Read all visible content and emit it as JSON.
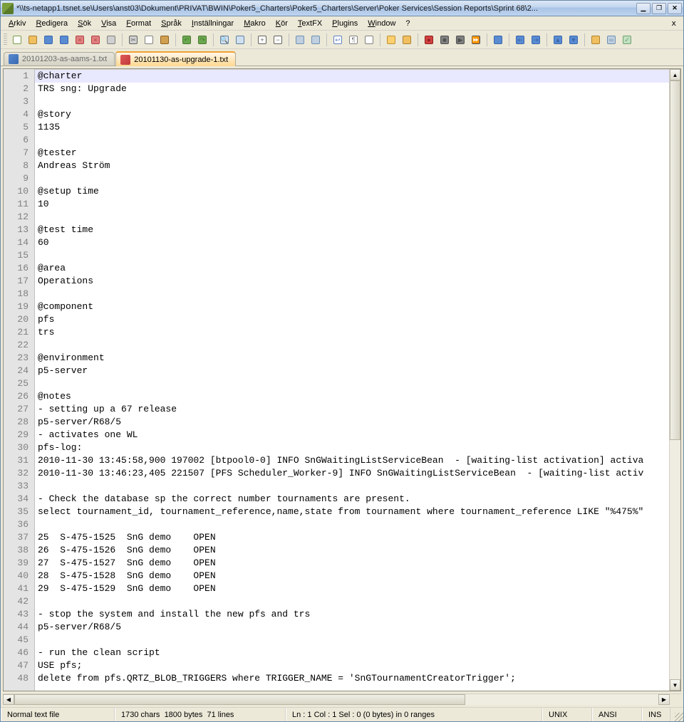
{
  "window": {
    "title_prefix": "*",
    "title_path": "\\\\ts-netapp1.tsnet.se\\Users\\anst03\\Dokument\\PRIVAT\\BWIN\\Poker5_Charters\\Poker5_Charters\\Server\\Poker Services\\Session Reports\\Sprint 68\\2..."
  },
  "menu": {
    "items": [
      "Arkiv",
      "Redigera",
      "Sök",
      "Visa",
      "Format",
      "Språk",
      "Inställningar",
      "Makro",
      "Kör",
      "TextFX",
      "Plugins",
      "Window",
      "?"
    ]
  },
  "toolbar1": {
    "icons": [
      "new-icon",
      "open-icon",
      "save-icon",
      "save-all-icon",
      "close-icon",
      "close-all-icon",
      "print-icon",
      "SEP",
      "cut-icon",
      "copy-icon",
      "paste-icon",
      "SEP",
      "undo-icon",
      "redo-icon",
      "SEP",
      "find-icon",
      "replace-icon",
      "SEP",
      "zoom-in-icon",
      "zoom-out-icon",
      "SEP",
      "sync-v-icon",
      "sync-h-icon",
      "SEP",
      "wrap-icon",
      "invisible-icon",
      "indent-guide-icon",
      "SEP",
      "lang-icon",
      "folder-icon",
      "SEP",
      "record-icon",
      "stop-icon",
      "play-icon",
      "play-multi-icon",
      "SEP",
      "save-macro-icon",
      "SEP",
      "outdent-icon",
      "indent-icon",
      "SEP",
      "collapse-icon",
      "expand-icon",
      "SEP",
      "explorer-icon",
      "link-icon",
      "spell-icon"
    ]
  },
  "tabs": [
    {
      "name": "20101203-as-aams-1.txt",
      "active": false,
      "iconColor": "blue"
    },
    {
      "name": "20101130-as-upgrade-1.txt",
      "active": true,
      "iconColor": "red"
    }
  ],
  "editor": {
    "lines": [
      "@charter",
      "TRS sng: Upgrade",
      "",
      "@story",
      "1135",
      "",
      "@tester",
      "Andreas Ström",
      "",
      "@setup time",
      "10",
      "",
      "@test time",
      "60",
      "",
      "@area",
      "Operations",
      "",
      "@component",
      "pfs",
      "trs",
      "",
      "@environment",
      "p5-server",
      "",
      "@notes",
      "- setting up a 67 release",
      "p5-server/R68/5",
      "- activates one WL",
      "pfs-log:",
      "2010-11-30 13:45:58,900 197002 [btpool0-0] INFO SnGWaitingListServiceBean  - [waiting-list activation] activa",
      "2010-11-30 13:46:23,405 221507 [PFS Scheduler_Worker-9] INFO SnGWaitingListServiceBean  - [waiting-list activ",
      "",
      "- Check the database sp the correct number tournaments are present.",
      "select tournament_id, tournament_reference,name,state from tournament where tournament_reference LIKE \"%475%\"",
      "",
      "25  S-475-1525  SnG demo    OPEN",
      "26  S-475-1526  SnG demo    OPEN",
      "27  S-475-1527  SnG demo    OPEN",
      "28  S-475-1528  SnG demo    OPEN",
      "29  S-475-1529  SnG demo    OPEN",
      "",
      "- stop the system and install the new pfs and trs",
      "p5-server/R68/5",
      "",
      "- run the clean script",
      "USE pfs;",
      "delete from pfs.QRTZ_BLOB_TRIGGERS where TRIGGER_NAME = 'SnGTournamentCreatorTrigger';"
    ],
    "current_line_index": 0
  },
  "status": {
    "filetype": "Normal text file",
    "chars": "1730 chars",
    "bytes": "1800 bytes",
    "lines": "71 lines",
    "pos": "Ln : 1    Col : 1    Sel : 0 (0 bytes) in 0 ranges",
    "eol": "UNIX",
    "enc": "ANSI",
    "mode": "INS"
  },
  "icon_glyphs": {
    "new-icon": {
      "fill": "#fff",
      "stroke": "#7a9a4a",
      "symbol": ""
    },
    "open-icon": {
      "fill": "#f0c060",
      "stroke": "#b08030",
      "symbol": ""
    },
    "save-icon": {
      "fill": "#5a8ad0",
      "stroke": "#3868b0",
      "symbol": ""
    },
    "save-all-icon": {
      "fill": "#5a8ad0",
      "stroke": "#3868b0",
      "symbol": ""
    },
    "close-icon": {
      "fill": "#e08080",
      "stroke": "#b04040",
      "symbol": "×"
    },
    "close-all-icon": {
      "fill": "#e08080",
      "stroke": "#b04040",
      "symbol": "×"
    },
    "print-icon": {
      "fill": "#d0d0d0",
      "stroke": "#808080",
      "symbol": ""
    },
    "cut-icon": {
      "fill": "#d0d0d0",
      "stroke": "#606060",
      "symbol": "✂"
    },
    "copy-icon": {
      "fill": "#fff",
      "stroke": "#808080",
      "symbol": ""
    },
    "paste-icon": {
      "fill": "#d0a050",
      "stroke": "#906020",
      "symbol": ""
    },
    "undo-icon": {
      "fill": "#6aa84f",
      "stroke": "#4a7a30",
      "symbol": "↶"
    },
    "redo-icon": {
      "fill": "#6aa84f",
      "stroke": "#4a7a30",
      "symbol": "↷"
    },
    "find-icon": {
      "fill": "#d0e0f0",
      "stroke": "#6080a0",
      "symbol": "🔍"
    },
    "replace-icon": {
      "fill": "#d0e0f0",
      "stroke": "#6080a0",
      "symbol": ""
    },
    "zoom-in-icon": {
      "fill": "#fff",
      "stroke": "#606060",
      "symbol": "+"
    },
    "zoom-out-icon": {
      "fill": "#fff",
      "stroke": "#606060",
      "symbol": "−"
    },
    "sync-v-icon": {
      "fill": "#c0d0e0",
      "stroke": "#7090b0",
      "symbol": ""
    },
    "sync-h-icon": {
      "fill": "#c0d0e0",
      "stroke": "#7090b0",
      "symbol": ""
    },
    "wrap-icon": {
      "fill": "#fff",
      "stroke": "#6080c0",
      "symbol": "↩"
    },
    "invisible-icon": {
      "fill": "#fff",
      "stroke": "#808080",
      "symbol": "¶"
    },
    "indent-guide-icon": {
      "fill": "#fff",
      "stroke": "#808080",
      "symbol": ""
    },
    "lang-icon": {
      "fill": "#ffd070",
      "stroke": "#c09030",
      "symbol": ""
    },
    "folder-icon": {
      "fill": "#f0c060",
      "stroke": "#b08030",
      "symbol": ""
    },
    "record-icon": {
      "fill": "#d04040",
      "stroke": "#902020",
      "symbol": "●"
    },
    "stop-icon": {
      "fill": "#808080",
      "stroke": "#505050",
      "symbol": "■"
    },
    "play-icon": {
      "fill": "#808080",
      "stroke": "#505050",
      "symbol": "▶"
    },
    "play-multi-icon": {
      "fill": "#808080",
      "stroke": "#505050",
      "symbol": "⏩"
    },
    "save-macro-icon": {
      "fill": "#5a8ad0",
      "stroke": "#3868b0",
      "symbol": ""
    },
    "outdent-icon": {
      "fill": "#5a8ad0",
      "stroke": "#3868b0",
      "symbol": "⇤"
    },
    "indent-icon": {
      "fill": "#5a8ad0",
      "stroke": "#3868b0",
      "symbol": "⇥"
    },
    "collapse-icon": {
      "fill": "#5a8ad0",
      "stroke": "#3868b0",
      "symbol": "▲"
    },
    "expand-icon": {
      "fill": "#5a8ad0",
      "stroke": "#3868b0",
      "symbol": "▼"
    },
    "explorer-icon": {
      "fill": "#f0c060",
      "stroke": "#b08030",
      "symbol": ""
    },
    "link-icon": {
      "fill": "#c0d0e0",
      "stroke": "#7090b0",
      "symbol": "∞"
    },
    "spell-icon": {
      "fill": "#c0e0c0",
      "stroke": "#70a070",
      "symbol": "✓"
    }
  }
}
